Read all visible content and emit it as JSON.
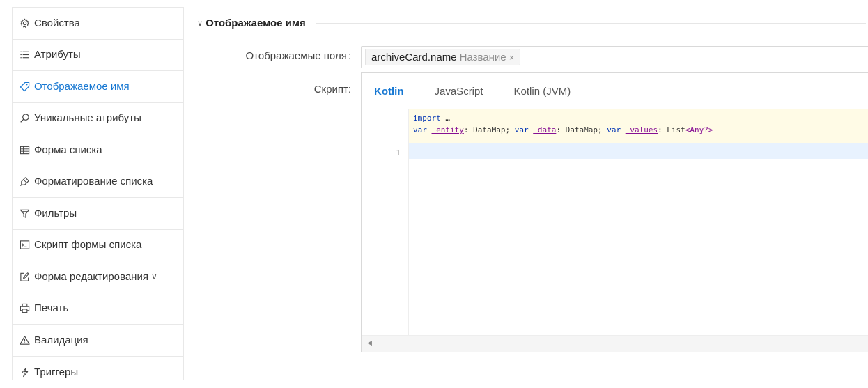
{
  "sidebar": {
    "items": [
      {
        "label": "Свойства",
        "icon": "gear-icon",
        "active": false
      },
      {
        "label": "Атрибуты",
        "icon": "list-icon",
        "active": false
      },
      {
        "label": "Отображаемое имя",
        "icon": "tag-icon",
        "active": true
      },
      {
        "label": "Уникальные атрибуты",
        "icon": "search-icon",
        "active": false
      },
      {
        "label": "Форма списка",
        "icon": "table-icon",
        "active": false
      },
      {
        "label": "Форматирование списка",
        "icon": "brush-icon",
        "active": false
      },
      {
        "label": "Фильтры",
        "icon": "filter-icon",
        "active": false
      },
      {
        "label": "Скрипт формы списка",
        "icon": "terminal-icon",
        "active": false
      },
      {
        "label": "Форма редактирования",
        "icon": "edit-icon",
        "active": false,
        "chevron": "∨"
      },
      {
        "label": "Печать",
        "icon": "printer-icon",
        "active": false
      },
      {
        "label": "Валидация",
        "icon": "warning-icon",
        "active": false
      },
      {
        "label": "Триггеры",
        "icon": "lightning-icon",
        "active": false
      }
    ]
  },
  "section": {
    "caret": "∨",
    "title": "Отображаемое имя"
  },
  "fields": {
    "display_label": "Отображаемые поля",
    "display_colon": ":",
    "chip_value": "archiveCard.name",
    "chip_sub": "Название",
    "chip_close": "×",
    "script_label": "Скрипт",
    "script_colon": ":"
  },
  "editor": {
    "tabs": [
      "Kotlin",
      "JavaScript",
      "Kotlin (JVM)"
    ],
    "active_tab": "Kotlin",
    "prelude_line1_kw": "import",
    "prelude_line1_rest": " …",
    "prelude_line2": {
      "kw1": "var",
      "id1": "_entity",
      "t1": ": DataMap; ",
      "kw2": "var",
      "id2": "_data",
      "t2": ": DataMap; ",
      "kw3": "var",
      "id3": "_values",
      "t3": ": List",
      "gen": "<Any?>"
    },
    "line_number": "1",
    "scroll_left": "◀"
  },
  "colors": {
    "accent": "#1677d2",
    "prelude_bg": "#fffbe6",
    "active_line_bg": "#e8f2fe"
  }
}
